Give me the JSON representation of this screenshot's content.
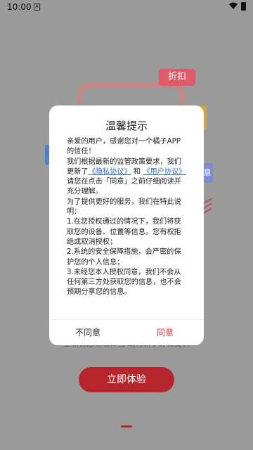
{
  "status_bar": {
    "time": "10:00",
    "small_icon": "A"
  },
  "background": {
    "tag_label": "折扣",
    "side_label": "意",
    "caption": "全新优惠领取体验 助力新手好物提供",
    "cta_label": "立即体验"
  },
  "dialog": {
    "title": "温馨提示",
    "p1": "亲爱的用户，感谢您对一个橘子APP的信任！",
    "p2a": "我们根据最新的监管政策要求，我们更新了",
    "privacy_link": "《隐私协议》",
    "p2b": " 和 ",
    "user_link": "《用户协议》",
    "p2c": "请您在点击「同意」之前仔细阅读并充分理解。",
    "p3": "为了提供更好的服务，我们在特此说明：",
    "item1": "1.在您授权通过的情况下，我们将获取您的设备、位置等信息。您有权拒绝或取消授权；",
    "item2": "2.系统的安全保障措施，会严密的保护您的个人信息；",
    "item3": "3.未经您本人授权同意，我们不会从任何第三方处获取您的信息，也不会预期分享您的信息。",
    "disagree_label": "不同意",
    "agree_label": "同意"
  },
  "colors": {
    "accent": "#e03e3e",
    "cta": "#b5252b",
    "link": "#2f6fd8"
  }
}
